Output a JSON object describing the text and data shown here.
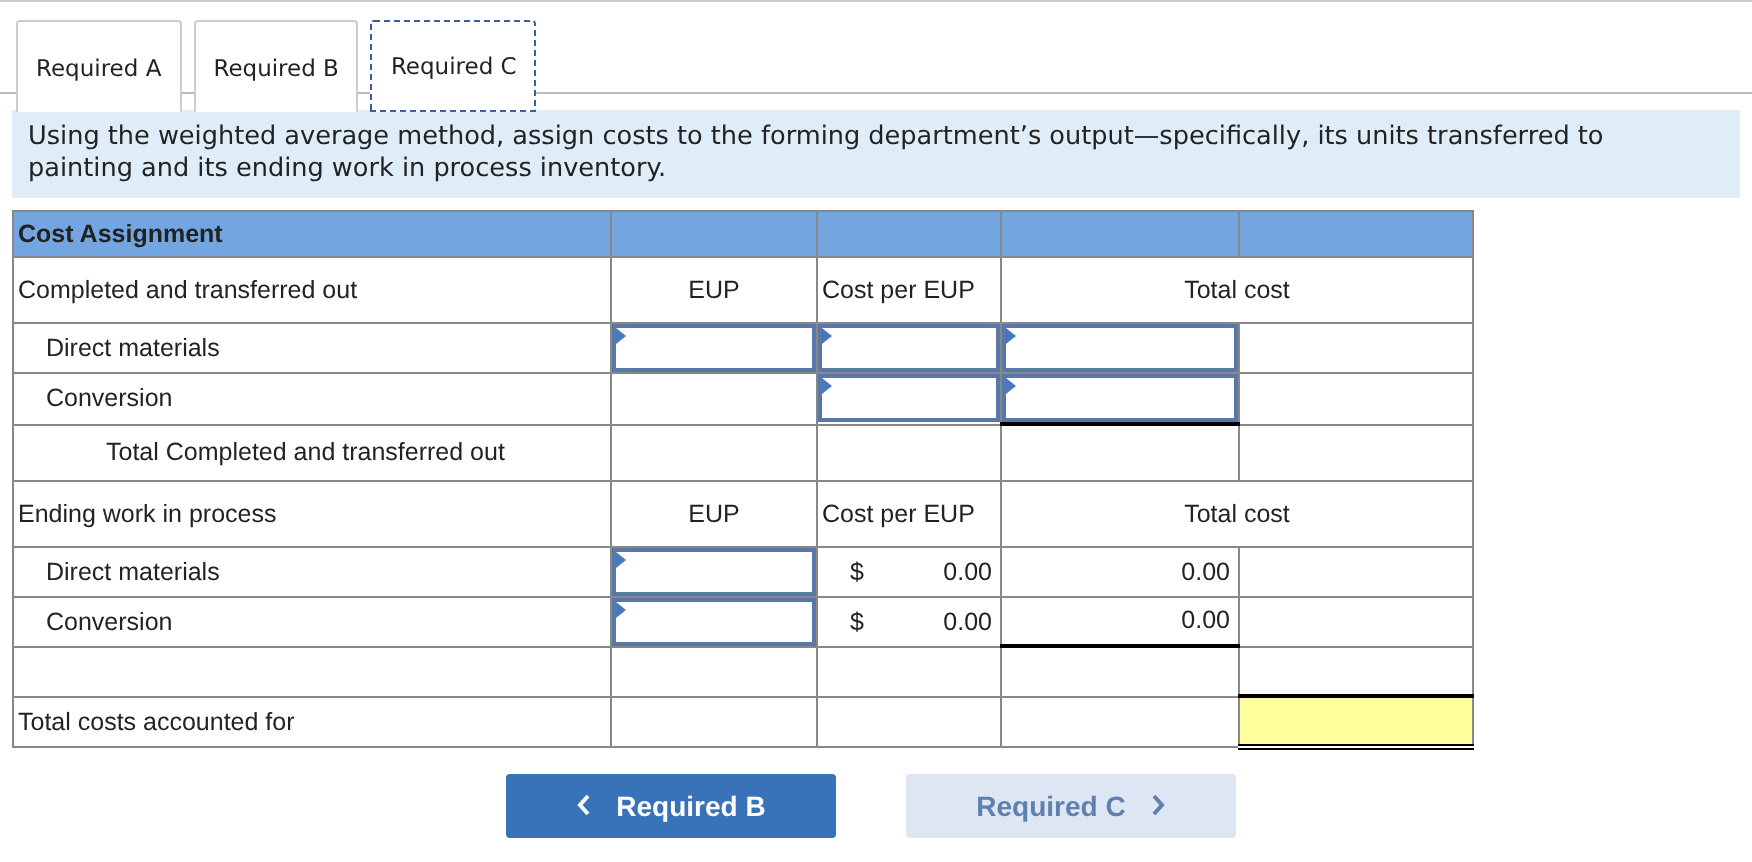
{
  "tabs": [
    {
      "label": "Required A",
      "selected": false
    },
    {
      "label": "Required B",
      "selected": false
    },
    {
      "label": "Required C",
      "selected": true
    }
  ],
  "instruction": "Using the weighted average method, assign costs to the forming department’s output—specifically, its units transferred to painting and its ending work in process inventory.",
  "table": {
    "title": "Cost Assignment",
    "sections": [
      {
        "label": "Completed and transferred out",
        "headers": [
          "EUP",
          "Cost per EUP",
          "Total cost"
        ],
        "rows": [
          {
            "label": "Direct materials",
            "cells": [
              {
                "kind": "input"
              },
              {
                "kind": "input"
              },
              {
                "kind": "input"
              }
            ]
          },
          {
            "label": "Conversion",
            "cells": [
              {
                "kind": "blank"
              },
              {
                "kind": "input"
              },
              {
                "kind": "input",
                "underlined": true
              }
            ]
          }
        ],
        "total": {
          "label": "Total Completed and transferred out"
        }
      },
      {
        "label": "Ending work in process",
        "headers": [
          "EUP",
          "Cost per EUP",
          "Total cost"
        ],
        "rows": [
          {
            "label": "Direct materials",
            "cells": [
              {
                "kind": "input"
              },
              {
                "kind": "amount",
                "currency": "$",
                "value": "0.00"
              },
              {
                "kind": "amount",
                "value": "0.00"
              }
            ]
          },
          {
            "label": "Conversion",
            "cells": [
              {
                "kind": "input"
              },
              {
                "kind": "amount",
                "currency": "$",
                "value": "0.00"
              },
              {
                "kind": "amount",
                "value": "0.00",
                "underlined": true
              }
            ]
          }
        ]
      }
    ],
    "grand_total": {
      "label": "Total costs accounted for",
      "highlighted": true
    }
  },
  "buttons": [
    {
      "label": "Required B",
      "kind": "prev",
      "disabled": false
    },
    {
      "label": "Required C",
      "kind": "next",
      "disabled": true
    }
  ]
}
